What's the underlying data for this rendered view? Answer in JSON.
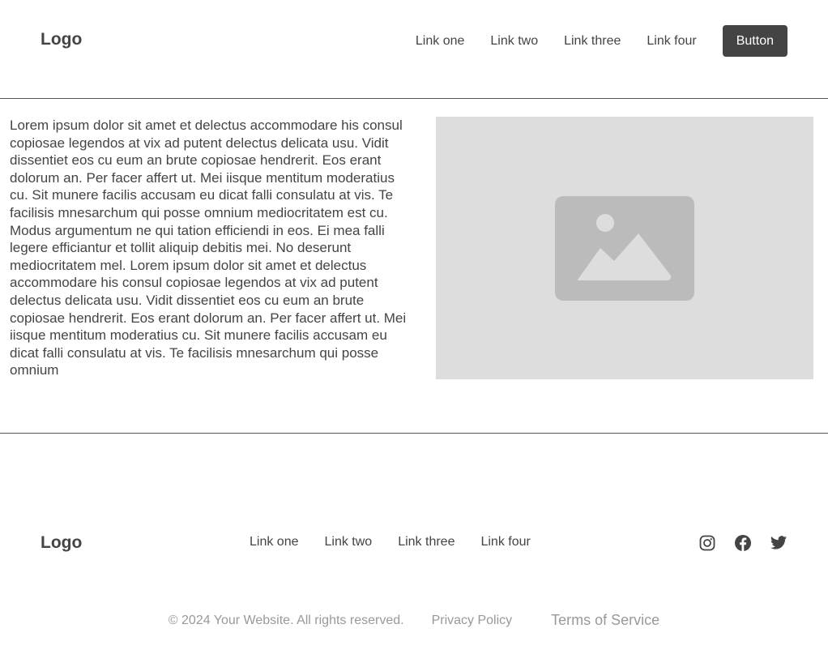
{
  "header": {
    "logo": "Logo",
    "nav": [
      "Link one",
      "Link two",
      "Link three",
      "Link four"
    ],
    "button_label": "Button"
  },
  "main": {
    "body_text": "Lorem ipsum dolor sit amet et delectus accommodare his consul copiosae legendos at vix ad putent delectus delicata usu. Vidit dissentiet eos cu eum an brute copiosae hendrerit. Eos erant dolorum an. Per facer affert ut. Mei iisque mentitum moderatius cu. Sit munere facilis accusam eu dicat falli consulatu at vis. Te facilisis mnesarchum qui posse omnium mediocritatem est cu. Modus argumentum ne qui tation efficiendi in eos. Ei mea falli legere efficiantur et tollit aliquip debitis mei. No deserunt mediocritatem mel. Lorem ipsum dolor sit amet et delectus accommodare his consul copiosae legendos at vix ad putent delectus delicata usu. Vidit dissentiet eos cu eum an brute copiosae hendrerit. Eos erant dolorum an. Per facer affert ut. Mei iisque mentitum moderatius cu. Sit munere facilis accusam eu dicat falli consulatu at vis. Te facilisis mnesarchum qui posse omnium",
    "image_icon": "image-placeholder-icon"
  },
  "footer": {
    "logo": "Logo",
    "nav": [
      "Link one",
      "Link two",
      "Link three",
      "Link four"
    ],
    "social_icons": [
      "instagram-icon",
      "facebook-icon",
      "twitter-icon"
    ],
    "copyright": "© 2024 Your Website. All rights reserved.",
    "privacy": "Privacy Policy",
    "terms": "Terms of Service"
  },
  "colors": {
    "text": "#444444",
    "button_bg": "#444444",
    "placeholder_bg": "#dddddd",
    "placeholder_icon": "#bbbbbb",
    "muted": "#999999"
  }
}
